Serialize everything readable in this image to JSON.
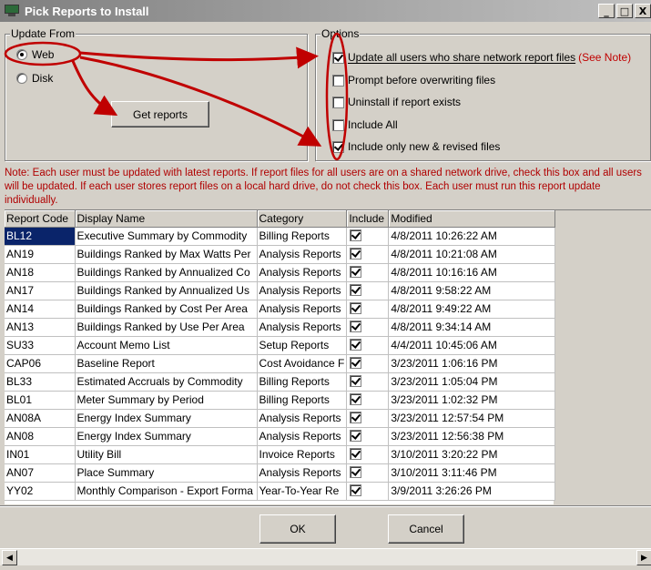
{
  "window": {
    "title": "Pick Reports to Install",
    "buttons": [
      "_",
      "□",
      "X"
    ]
  },
  "update_from": {
    "label": "Update From",
    "options": [
      {
        "label": "Web",
        "selected": true
      },
      {
        "label": "Disk",
        "selected": false
      }
    ],
    "get_reports_label": "Get reports"
  },
  "options": {
    "label": "Options",
    "items": [
      {
        "label": "Update all users who share network report files",
        "checked": true
      },
      {
        "label": "Prompt before overwriting files",
        "checked": false
      },
      {
        "label": "Uninstall if report exists",
        "checked": false
      },
      {
        "label": "Include All",
        "checked": false
      },
      {
        "label": "Include only new & revised files",
        "checked": true
      }
    ],
    "see_note": "(See Note)"
  },
  "note": "Note: Each user must be updated with latest reports. If report files for all users are on a shared network drive, check this box and all users will be updated. If each user stores report files on a local hard drive, do not check this box. Each user must run this report update individually.",
  "table": {
    "columns": [
      "Report Code",
      "Display Name",
      "Category",
      "Include",
      "Modified"
    ],
    "rows": [
      {
        "code": "BL12",
        "name": "Executive Summary by Commodity",
        "category": "Billing Reports",
        "include": true,
        "modified": "4/8/2011 10:26:22 AM"
      },
      {
        "code": "AN19",
        "name": "Buildings Ranked by Max Watts Per",
        "category": "Analysis Reports",
        "include": true,
        "modified": "4/8/2011 10:21:08 AM"
      },
      {
        "code": "AN18",
        "name": "Buildings Ranked by Annualized Co",
        "category": "Analysis Reports",
        "include": true,
        "modified": "4/8/2011 10:16:16 AM"
      },
      {
        "code": "AN17",
        "name": "Buildings Ranked by Annualized Us",
        "category": "Analysis Reports",
        "include": true,
        "modified": "4/8/2011 9:58:22 AM"
      },
      {
        "code": "AN14",
        "name": " Buildings Ranked by Cost Per Area",
        "category": "Analysis Reports",
        "include": true,
        "modified": "4/8/2011 9:49:22 AM"
      },
      {
        "code": "AN13",
        "name": "Buildings Ranked by Use Per Area",
        "category": "Analysis Reports",
        "include": true,
        "modified": "4/8/2011 9:34:14 AM"
      },
      {
        "code": "SU33",
        "name": "Account Memo List",
        "category": "Setup Reports",
        "include": true,
        "modified": "4/4/2011 10:45:06 AM"
      },
      {
        "code": "CAP06",
        "name": "Baseline Report",
        "category": "Cost Avoidance F",
        "include": true,
        "modified": "3/23/2011 1:06:16 PM"
      },
      {
        "code": "BL33",
        "name": "Estimated Accruals by Commodity",
        "category": "Billing Reports",
        "include": true,
        "modified": "3/23/2011 1:05:04 PM"
      },
      {
        "code": "BL01",
        "name": "Meter Summary by Period",
        "category": "Billing Reports",
        "include": true,
        "modified": "3/23/2011 1:02:32 PM"
      },
      {
        "code": "AN08A",
        "name": "Energy Index Summary",
        "category": "Analysis Reports",
        "include": true,
        "modified": "3/23/2011 12:57:54 PM"
      },
      {
        "code": "AN08",
        "name": "Energy Index Summary",
        "category": "Analysis Reports",
        "include": true,
        "modified": "3/23/2011 12:56:38 PM"
      },
      {
        "code": "IN01",
        "name": "Utility Bill",
        "category": "Invoice Reports",
        "include": true,
        "modified": "3/10/2011 3:20:22 PM"
      },
      {
        "code": "AN07",
        "name": "Place Summary",
        "category": "Analysis Reports",
        "include": true,
        "modified": "3/10/2011 3:11:46 PM"
      },
      {
        "code": "YY02",
        "name": "Monthly Comparison - Export Forma",
        "category": "Year-To-Year Re",
        "include": true,
        "modified": "3/9/2011 3:26:26 PM"
      }
    ]
  },
  "footer": {
    "ok_label": "OK",
    "cancel_label": "Cancel"
  },
  "colors": {
    "annotation_arrow": "#c00000",
    "selection": "#0a246a",
    "dialog_bg": "#d4d0c8"
  }
}
